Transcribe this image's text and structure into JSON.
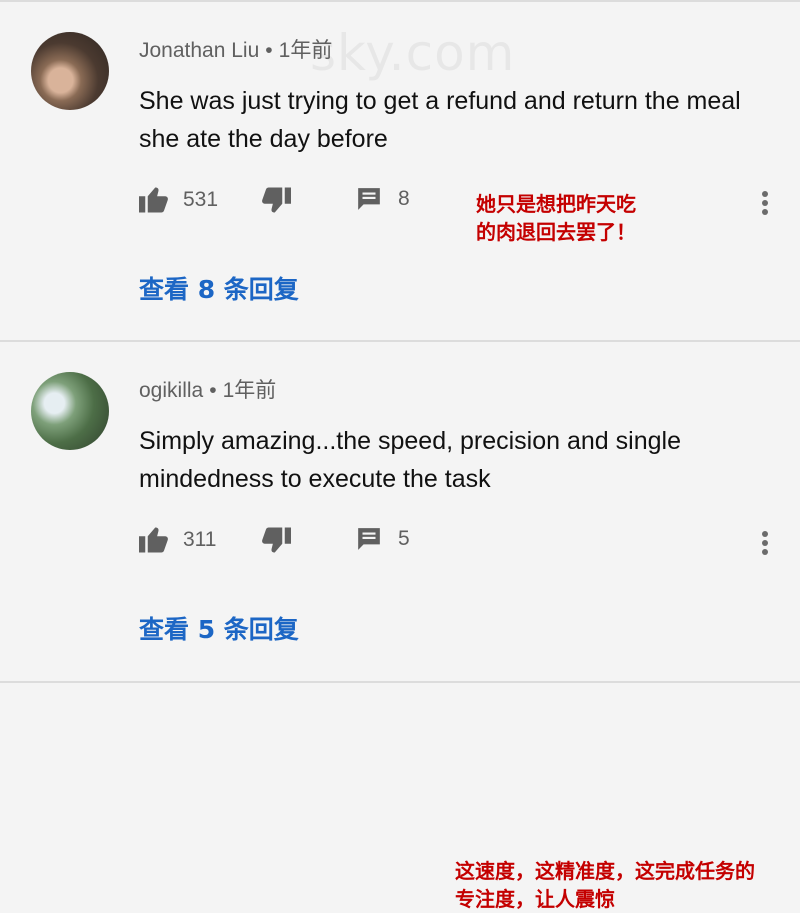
{
  "watermark": "sky.com",
  "comments": [
    {
      "author": "Jonathan Liu",
      "time": "1年前",
      "text": "She was just trying to get a refund and return the meal she ate the day before",
      "likes": "531",
      "replies": "8",
      "annotation": "她只是想把昨天吃\n的肉退回去罢了！",
      "view_replies": "查看 8 条回复"
    },
    {
      "author": "ogikilla",
      "time": "1年前",
      "text": "Simply amazing...the speed, precision and single mindedness to execute the task",
      "likes": "311",
      "replies": "5",
      "annotation": "这速度，这精准度，这完成任务的专注度，让人震惊",
      "view_replies": "查看 5 条回复"
    }
  ],
  "icons": {
    "like": "thumb-up-icon",
    "dislike": "thumb-down-icon",
    "reply": "comment-icon",
    "more": "more-vertical-icon"
  },
  "colors": {
    "link": "#1c66c5",
    "annotation": "#c40000",
    "meta": "#606060"
  }
}
